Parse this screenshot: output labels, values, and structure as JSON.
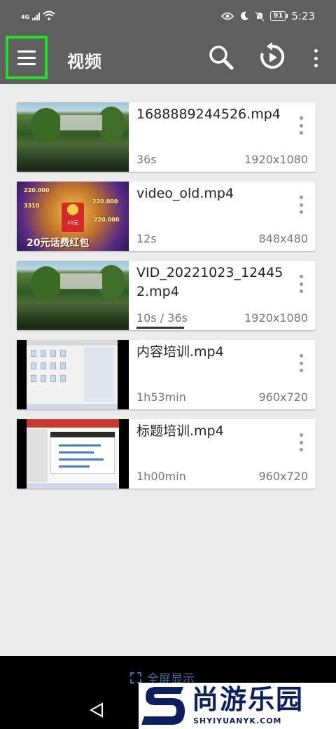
{
  "status_bar": {
    "network": "4G",
    "battery": "91",
    "time": "5:23"
  },
  "app_bar": {
    "title": "视频",
    "icons": [
      "menu-icon",
      "search-icon",
      "replay-icon",
      "more-vert-icon"
    ]
  },
  "videos": [
    {
      "name": "1688889244526.mp4",
      "duration": "36s",
      "resolution": "1920x1080",
      "thumbnail": "nature-pond"
    },
    {
      "name": "video_old.mp4",
      "duration": "12s",
      "resolution": "848x480",
      "thumbnail": "game-red-envelope",
      "thumbnail_caption": "20元话费红包",
      "thumbnail_envelope_text": "20元",
      "thumbnail_numbers": [
        "220.000",
        "220.000",
        "220.000",
        "3310"
      ]
    },
    {
      "name": "VID_20221023_124452.mp4",
      "duration": "10s / 36s",
      "resolution": "1920x1080",
      "thumbnail": "nature-pond",
      "progress_fraction": 0.28
    },
    {
      "name": "内容培训.mp4",
      "duration": "1h53min",
      "resolution": "960x720",
      "thumbnail": "screen-recording"
    },
    {
      "name": "标题培训.mp4",
      "duration": "1h00min",
      "resolution": "960x720",
      "thumbnail": "slide-recording"
    }
  ],
  "bottom": {
    "fullscreen_label": "全屏显示"
  },
  "watermark": {
    "brand": "尚游乐园",
    "url": "SHYIYUANYK.COM"
  },
  "colors": {
    "app_bar": "#5f5f5f",
    "highlight": "#22e022",
    "background": "#ececec",
    "link_blue": "#3d6fb0",
    "watermark_navy": "#0d1f5c"
  }
}
